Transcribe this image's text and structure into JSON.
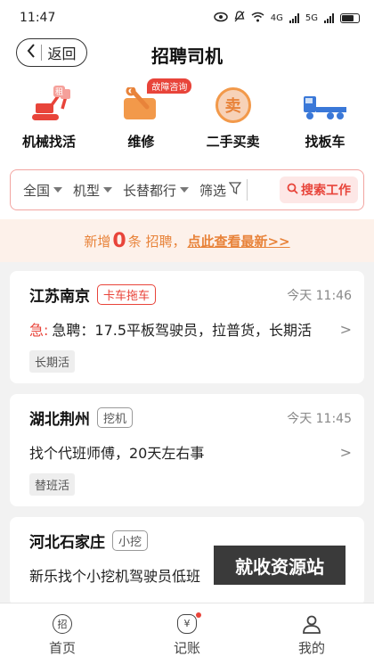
{
  "status": {
    "time": "11:47",
    "net1": "4G",
    "net2": "5G"
  },
  "header": {
    "back_label": "返回",
    "title": "招聘司机"
  },
  "categories": [
    {
      "label": "机械找活",
      "icon": "excavator-icon",
      "mini_badge": "租"
    },
    {
      "label": "维修",
      "icon": "repair-icon",
      "badge": "故障咨询"
    },
    {
      "label": "二手买卖",
      "icon": "sell-icon",
      "glyph": "卖"
    },
    {
      "label": "找板车",
      "icon": "flatbed-truck-icon"
    }
  ],
  "filters": [
    {
      "label": "全国"
    },
    {
      "label": "机型"
    },
    {
      "label": "长替都行"
    },
    {
      "label": "筛选"
    }
  ],
  "search_button": "搜索工作",
  "notice": {
    "prefix": "新增",
    "count": "0",
    "middle": "条 招聘，",
    "link": "点此查看最新>>"
  },
  "jobs": [
    {
      "location": "江苏南京",
      "tag": "卡车拖车",
      "tag_red": true,
      "time": "今天 11:46",
      "urgent": "急:",
      "desc": "急聘：17.5平板驾驶员，拉普货，长期活",
      "chip": "长期活"
    },
    {
      "location": "湖北荆州",
      "tag": "挖机",
      "tag_red": false,
      "time": "今天 11:45",
      "urgent": "",
      "desc": "找个代班师傅，20天左右事",
      "chip": "替班活"
    },
    {
      "location": "河北石家庄",
      "tag": "小挖",
      "tag_red": false,
      "time": "",
      "urgent": "",
      "desc": "新乐找个小挖机驾驶员低班",
      "chip": ""
    }
  ],
  "arrow": ">",
  "watermark": "就收资源站",
  "tabs": [
    {
      "label": "首页",
      "icon": "recruit-icon",
      "glyph": "招"
    },
    {
      "label": "记账",
      "icon": "money-bag-icon",
      "glyph": "¥"
    },
    {
      "label": "我的",
      "icon": "user-icon"
    }
  ],
  "colors": {
    "accent": "#e8443a",
    "orange": "#e8833a",
    "truck_blue": "#3a78d8"
  }
}
